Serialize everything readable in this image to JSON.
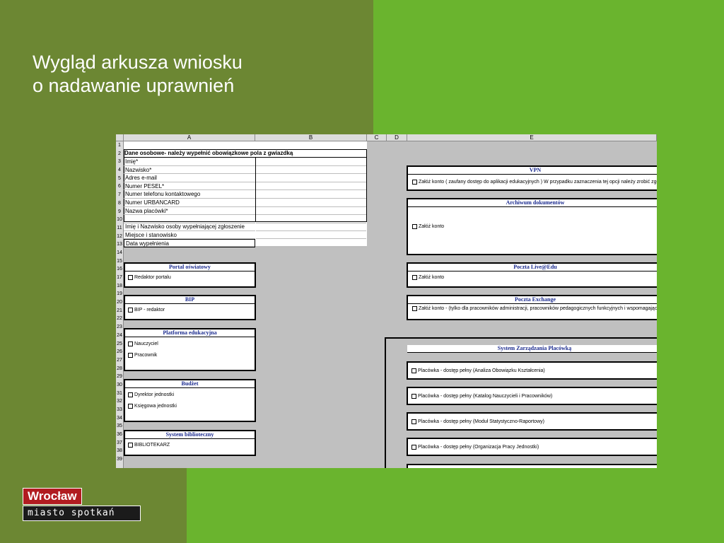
{
  "slide": {
    "title_line1": "Wygląd arkusza wniosku",
    "title_line2": "o nadawanie uprawnień"
  },
  "logo": {
    "top": "Wrocław",
    "bottom": "miasto spotkań",
    "colors": {
      "top_bg": "#b11c20",
      "bottom_bg": "#1b1b1b"
    }
  },
  "spreadsheet": {
    "columns": [
      "A",
      "B",
      "C",
      "D",
      "E"
    ],
    "row_numbers": [
      "1",
      "2",
      "3",
      "4",
      "5",
      "6",
      "7",
      "8",
      "9",
      "10",
      "11",
      "12",
      "13",
      "14",
      "15",
      "16",
      "17",
      "18",
      "19",
      "20",
      "21",
      "22",
      "23",
      "24",
      "25",
      "26",
      "27",
      "28",
      "29",
      "30",
      "31",
      "32",
      "33",
      "34",
      "35",
      "36",
      "37",
      "38",
      "39"
    ],
    "personal_header": "Dane osobowe- należy wypełnić obowiązkowe pola z gwiazdką",
    "personal_fields": [
      "Imię*",
      "Nazwisko*",
      "Adres e-mail",
      "Numer PESEL*",
      "Numer telefonu kontaktowego",
      "Numer URBANCARD",
      "Nazwa placówki*",
      ""
    ],
    "filler_fields": [
      "Imię i Nazwisko osoby wypełniającej zgłoszenie",
      "Miejsce i stanowisko",
      "Data wypełnienia"
    ],
    "left_panels": [
      {
        "title": "Portal oświatowy",
        "items": [
          "Redaktor portalu"
        ]
      },
      {
        "title": "BIP",
        "items": [
          "BIP - redaktor"
        ]
      },
      {
        "title": "Platforma edukacyjna",
        "items": [
          "Nauczyciel",
          "Pracownik"
        ]
      },
      {
        "title": "Budżet",
        "items": [
          "Dyrektor jednostki",
          "Księgowa jednostki"
        ]
      },
      {
        "title": "System biblioteczny",
        "items": [
          "BIBLIOTEKARZ"
        ]
      }
    ],
    "right_panels": [
      {
        "title": "VPN",
        "items": [
          "Załóż konto ( zaufany dostęp do aplikacji edukacyjnych ) W przypadku zaznaczenia tej opcji należy zrobić zgłoszenie"
        ]
      },
      {
        "title": "Archiwum dokumentów",
        "items": [
          "Załóż konto"
        ]
      },
      {
        "title": "Poczta Live@Edu",
        "items": [
          "Załóż konto"
        ]
      },
      {
        "title": "Poczta Exchange",
        "items": [
          "Załóż konto -  (tylko dla pracowników administracji, pracowników pedagogicznych funkcyjnych i wspomagających)"
        ]
      }
    ],
    "szp": {
      "title": "System Zarządzania Placówką",
      "items": [
        "Placówka - dostęp pełny (Analiza Obowiązku Kształcenia)",
        "Placówka - dostęp pełny (Katalog Nauczycieli i Pracowników)",
        "Placówka - dostęp pełny (Moduł Statystyczno-Raportowy)",
        "Placówka - dostęp pełny (Organizacja Pracy Jednostki)"
      ]
    },
    "colors": {
      "panel_title": "#1b2b8f",
      "sheet_bg": "#c0c0c0"
    }
  }
}
